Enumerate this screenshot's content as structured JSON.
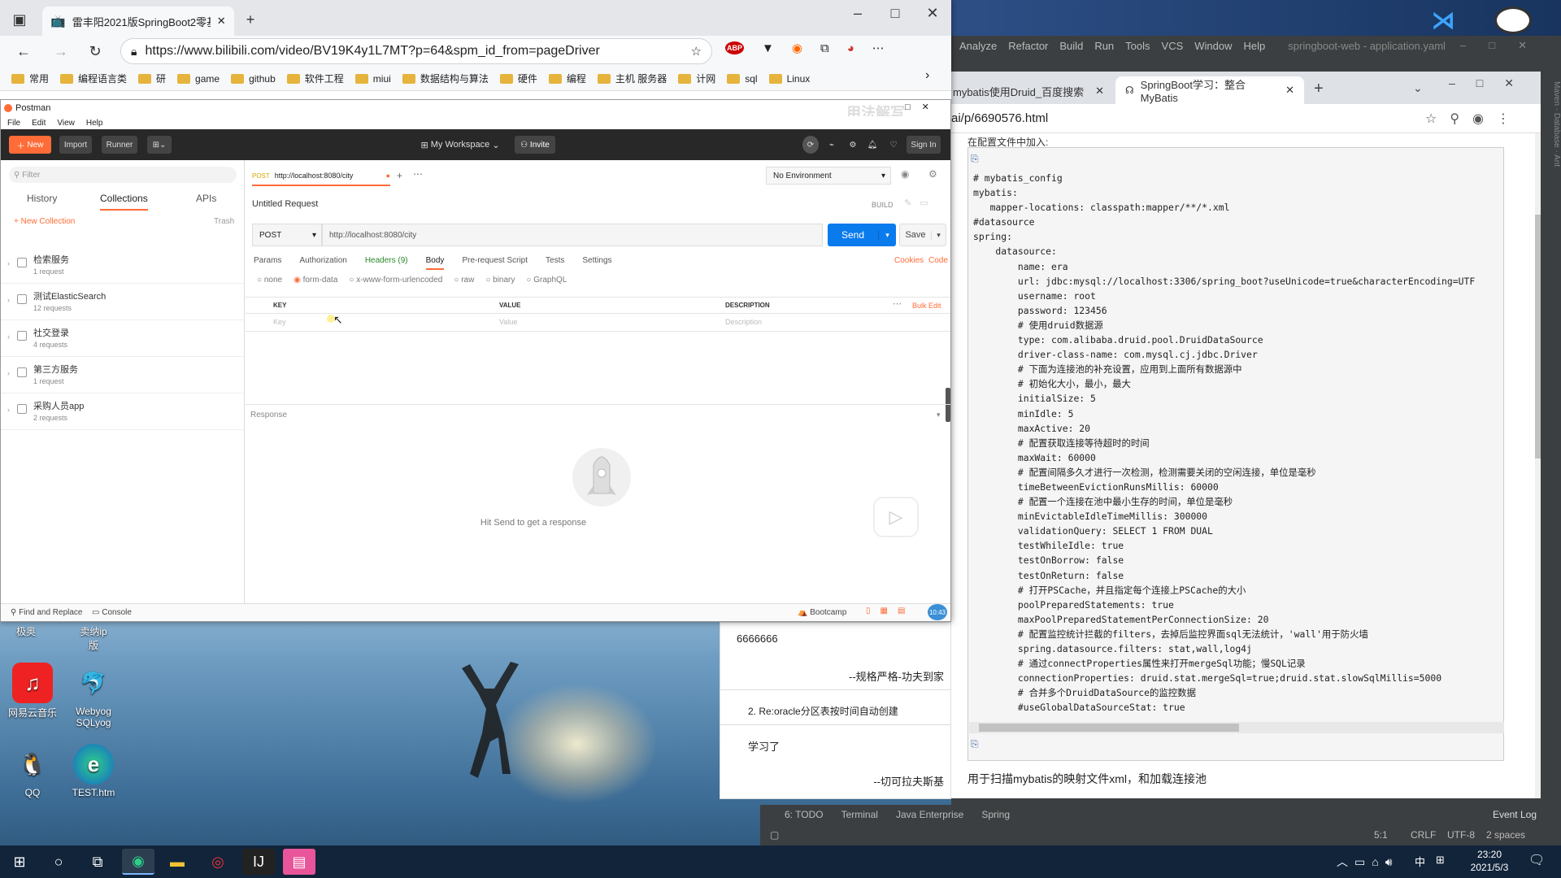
{
  "browser": {
    "tab_title": "雷丰阳2021版SpringBoot2零基",
    "url": "https://www.bilibili.com/video/BV19K4y1L7MT?p=64&spm_id_from=pageDriver",
    "favorites": [
      "常用",
      "编程语言类",
      "研",
      "game",
      "github",
      "软件工程",
      "miui",
      "数据结构与算法",
      "硬件",
      "编程",
      "主机 服务器",
      "计网",
      "sql",
      "Linux"
    ],
    "overlay_text": "用法解写"
  },
  "postman": {
    "title": "Postman",
    "menu": [
      "File",
      "Edit",
      "View",
      "Help"
    ],
    "new_label": "New",
    "import_label": "Import",
    "runner_label": "Runner",
    "workspace": "My Workspace",
    "invite": "Invite",
    "signin": "Sign In",
    "filter_placeholder": "Filter",
    "side_tabs": [
      "History",
      "Collections",
      "APIs"
    ],
    "new_collection": "+ New Collection",
    "trash": "Trash",
    "collections": [
      {
        "name": "检索服务",
        "count": "1 request"
      },
      {
        "name": "测试ElasticSearch",
        "count": "12 requests"
      },
      {
        "name": "社交登录",
        "count": "4 requests"
      },
      {
        "name": "第三方服务",
        "count": "1 request"
      },
      {
        "name": "采购人员app",
        "count": "2 requests"
      }
    ],
    "request_tab": "http://localhost:8080/city",
    "request_tab_method": "POST",
    "environment": "No Environment",
    "request_name": "Untitled Request",
    "build": "BUILD",
    "method": "POST",
    "url": "http://localhost:8080/city",
    "send": "Send",
    "save": "Save",
    "tabs": [
      "Params",
      "Authorization",
      "Headers (9)",
      "Body",
      "Pre-request Script",
      "Tests",
      "Settings"
    ],
    "cookies": "Cookies",
    "code": "Code",
    "body_types": [
      "none",
      "form-data",
      "x-www-form-urlencoded",
      "raw",
      "binary",
      "GraphQL"
    ],
    "table_headers": [
      "KEY",
      "VALUE",
      "DESCRIPTION"
    ],
    "bulk_edit": "Bulk Edit",
    "key_placeholder": "Key",
    "value_placeholder": "Value",
    "desc_placeholder": "Description",
    "response": "Response",
    "hint": "Hit Send to get a response",
    "find_replace": "Find and Replace",
    "console": "Console",
    "bootcamp": "Bootcamp",
    "clock": "10:43"
  },
  "ide": {
    "menu": [
      "Analyze",
      "Refactor",
      "Build",
      "Run",
      "Tools",
      "VCS",
      "Window",
      "Help"
    ],
    "project": "springboot-web - application.yaml",
    "status_tabs": [
      "6: TODO",
      "Terminal",
      "Java Enterprise",
      "Spring"
    ],
    "event_log": "Event Log",
    "status_right": [
      "5:1",
      "CRLF",
      "UTF-8",
      "2 spaces"
    ]
  },
  "chrome": {
    "tabs": [
      "mybatis使用Druid_百度搜索",
      "SpringBoot学习：整合MyBatis"
    ],
    "url": "ai/p/6690576.html",
    "code_lines": [
      "# mybatis_config",
      "mybatis:",
      "   mapper-locations: classpath:mapper/**/*.xml",
      "#datasource",
      "spring:",
      "    datasource:",
      "        name: era",
      "        url: jdbc:mysql://localhost:3306/spring_boot?useUnicode=true&characterEncoding=UTF",
      "        username: root",
      "        password: 123456",
      "        # 使用druid数据源",
      "        type: com.alibaba.druid.pool.DruidDataSource",
      "        driver-class-name: com.mysql.cj.jdbc.Driver",
      "        # 下面为连接池的补充设置，应用到上面所有数据源中",
      "        # 初始化大小，最小，最大",
      "        initialSize: 5",
      "        minIdle: 5",
      "        maxActive: 20",
      "        # 配置获取连接等待超时的时间",
      "        maxWait: 60000",
      "        # 配置间隔多久才进行一次检测，检测需要关闭的空闲连接，单位是毫秒",
      "        timeBetweenEvictionRunsMillis: 60000",
      "        # 配置一个连接在池中最小生存的时间，单位是毫秒",
      "        minEvictableIdleTimeMillis: 300000",
      "        validationQuery: SELECT 1 FROM DUAL",
      "        testWhileIdle: true",
      "        testOnBorrow: false",
      "        testOnReturn: false",
      "        # 打开PSCache，并且指定每个连接上PSCache的大小",
      "        poolPreparedStatements: true",
      "        maxPoolPreparedStatementPerConnectionSize: 20",
      "        # 配置监控统计拦截的filters，去掉后监控界面sql无法统计，'wall'用于防火墙",
      "        spring.datasource.filters: stat,wall,log4j",
      "        # 通过connectProperties属性来打开mergeSql功能；慢SQL记录",
      "        connectionProperties: druid.stat.mergeSql=true;druid.stat.slowSqlMillis=5000",
      "        # 合并多个DruidDataSource的监控数据",
      "        #useGlobalDataSourceStat: true"
    ],
    "caption": "用于扫描mybatis的映射文件xml，和加载连接池"
  },
  "comments": {
    "c1": "6666666",
    "c1_author": "--规格严格-功夫到家",
    "c2": "2. Re:oracle分区表按时间自动创建",
    "c2_body": "学习了",
    "c2_author": "--切可拉夫斯基"
  },
  "desktop": {
    "icons": [
      {
        "label": "网易云音乐"
      },
      {
        "label": "Webyog SQLyog"
      },
      {
        "label": "QQ"
      },
      {
        "label": "TEST.htm"
      }
    ],
    "top_icon_labels": [
      "极奥",
      "卖纳ip",
      "版"
    ]
  },
  "taskbar": {
    "time": "23:20",
    "date": "2021/5/3",
    "ime": "中"
  }
}
